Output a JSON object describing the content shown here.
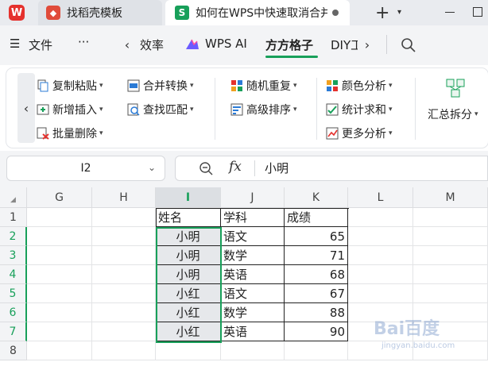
{
  "tabs": {
    "home_logo": "W",
    "docer_label": "找稻壳模板",
    "doc_label": "如何在WPS中快速取消合并",
    "doc_logo": "S",
    "new_tab": "+",
    "new_tab_caret": "▾"
  },
  "menu": {
    "hamburger": "☰",
    "file": "文件",
    "more": "···",
    "prev": "‹",
    "next": "›",
    "items": [
      "效率",
      "WPS AI",
      "方方格子",
      "DIY工"
    ],
    "active_item": "方方格子",
    "search_icon": "search-icon"
  },
  "ribbon": {
    "scroll_left": "‹",
    "group1": [
      {
        "label": "复制粘贴",
        "icon": "copy-paste-icon"
      },
      {
        "label": "新增插入",
        "icon": "insert-icon"
      },
      {
        "label": "批量删除",
        "icon": "batch-delete-icon"
      }
    ],
    "group2": [
      {
        "label": "合并转换",
        "icon": "merge-convert-icon"
      },
      {
        "label": "查找匹配",
        "icon": "find-match-icon"
      }
    ],
    "group3": [
      {
        "label": "随机重复",
        "icon": "random-repeat-icon"
      },
      {
        "label": "高级排序",
        "icon": "advanced-sort-icon"
      }
    ],
    "group4": [
      {
        "label": "颜色分析",
        "icon": "color-analysis-icon"
      },
      {
        "label": "统计求和",
        "icon": "stat-sum-icon"
      },
      {
        "label": "更多分析",
        "icon": "more-analysis-icon"
      }
    ],
    "summary_split": "汇总拆分",
    "caret": "▾"
  },
  "formula_bar": {
    "name_box": "I2",
    "fx": "fx",
    "value": "小明"
  },
  "grid": {
    "corner": "◢",
    "columns": [
      "G",
      "H",
      "I",
      "J",
      "K",
      "L",
      "M"
    ],
    "selected_column": "I",
    "rows": [
      "1",
      "2",
      "3",
      "4",
      "5",
      "6",
      "7",
      "8"
    ],
    "header_row": [
      "姓名",
      "学科",
      "成绩"
    ],
    "data": [
      {
        "name": "小明",
        "subject": "语文",
        "score": "65"
      },
      {
        "name": "小明",
        "subject": "数学",
        "score": "71"
      },
      {
        "name": "小明",
        "subject": "英语",
        "score": "68"
      },
      {
        "name": "小红",
        "subject": "语文",
        "score": "67"
      },
      {
        "name": "小红",
        "subject": "数学",
        "score": "88"
      },
      {
        "name": "小红",
        "subject": "英语",
        "score": "90"
      }
    ]
  },
  "watermark": {
    "text": "Bai百度",
    "sub": "jingyan.baidu.com"
  },
  "colors": {
    "accent": "#18a05a",
    "wps_red": "#e5312d"
  }
}
